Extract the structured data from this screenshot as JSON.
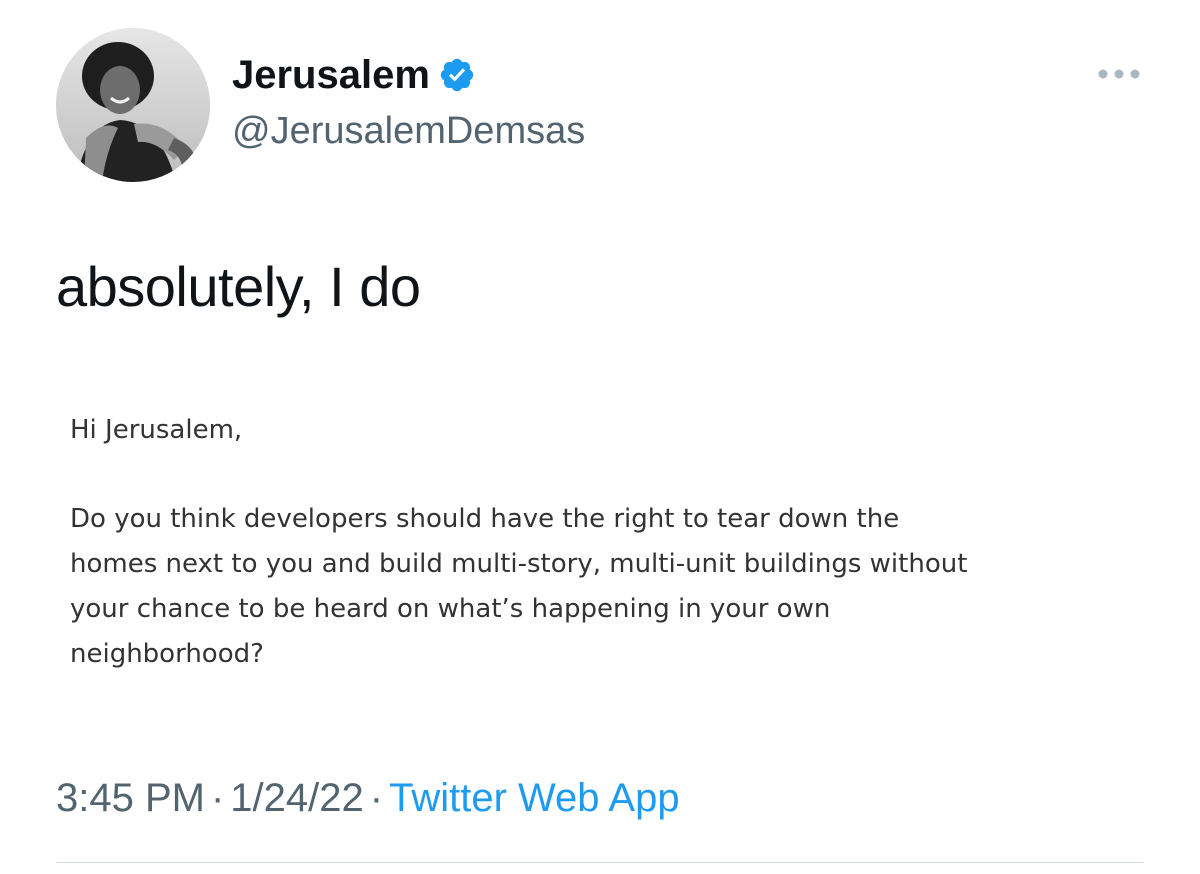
{
  "author": {
    "display_name": "Jerusalem",
    "handle": "@JerusalemDemsas",
    "verified": true
  },
  "icons": {
    "verified": "verified-badge-icon",
    "more": "more-options-icon"
  },
  "colors": {
    "accent": "#1d9bf0",
    "secondary_text": "#536471",
    "primary_text": "#0f1419"
  },
  "tweet": {
    "text": "absolutely, I do"
  },
  "attached_email": {
    "greeting": "Hi Jerusalem,",
    "body_lines": [
      "Do you think developers should have the right to tear down the",
      "homes next to you and build multi-story, multi-unit buildings without",
      "your chance to be heard on what’s happening in your own",
      "neighborhood?"
    ]
  },
  "meta": {
    "time": "3:45 PM",
    "separator": "·",
    "date": "1/24/22",
    "source": "Twitter Web App"
  }
}
